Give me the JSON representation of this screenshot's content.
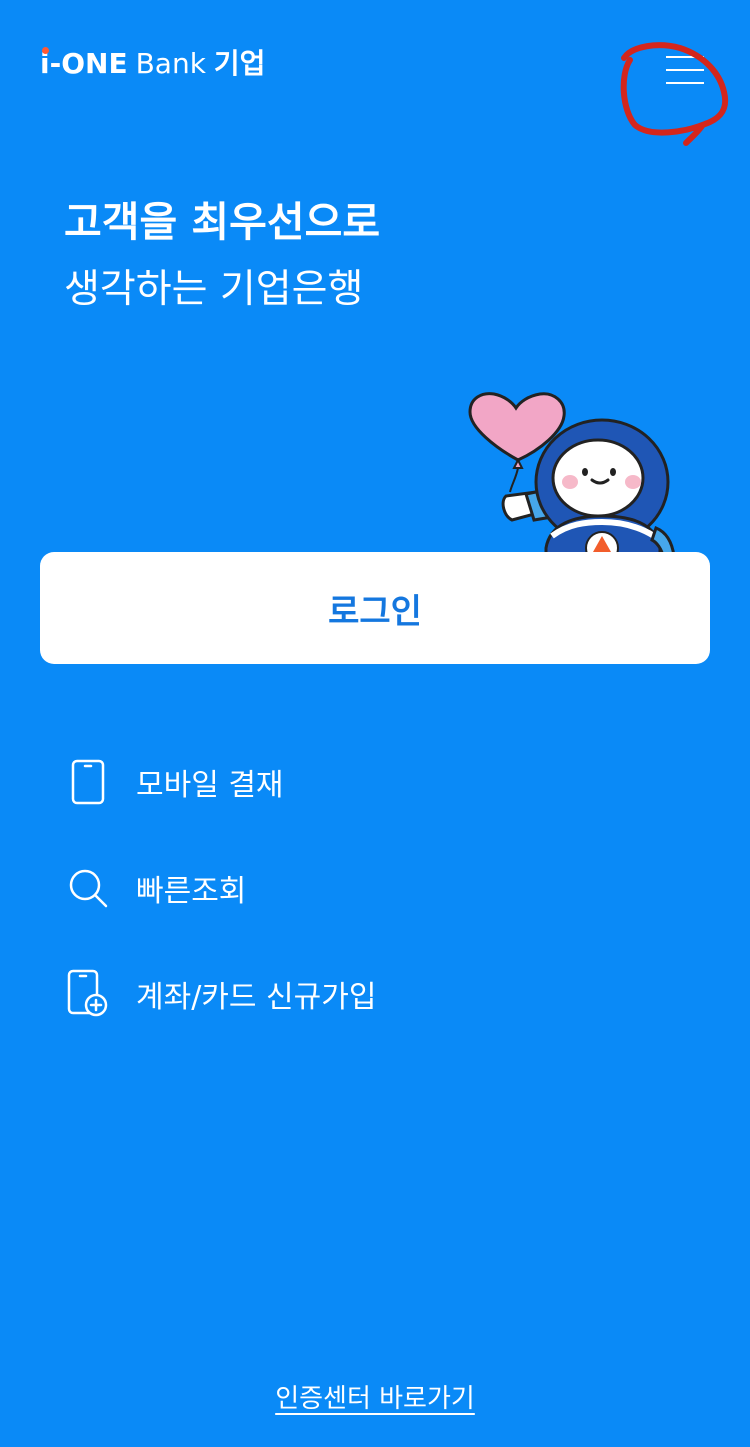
{
  "header": {
    "logo": {
      "brand": "i-ONE",
      "bank": "Bank",
      "korean": "기업"
    },
    "menu_icon": "hamburger-menu-icon"
  },
  "hero": {
    "line1": "고객을 최우선으로",
    "line2": "생각하는 기업은행"
  },
  "login": {
    "label": "로그인"
  },
  "quick_menu": [
    {
      "label": "모바일 결재",
      "icon": "phone-icon"
    },
    {
      "label": "빠른조회",
      "icon": "search-icon"
    },
    {
      "label": "계좌/카드 신규가입",
      "icon": "phone-add-icon"
    }
  ],
  "footer": {
    "link": "인증센터 바로가기"
  },
  "colors": {
    "background": "#0a8af7",
    "login_text": "#1477df",
    "logo_dot": "#ff5a36",
    "annotation": "#d4261c"
  }
}
